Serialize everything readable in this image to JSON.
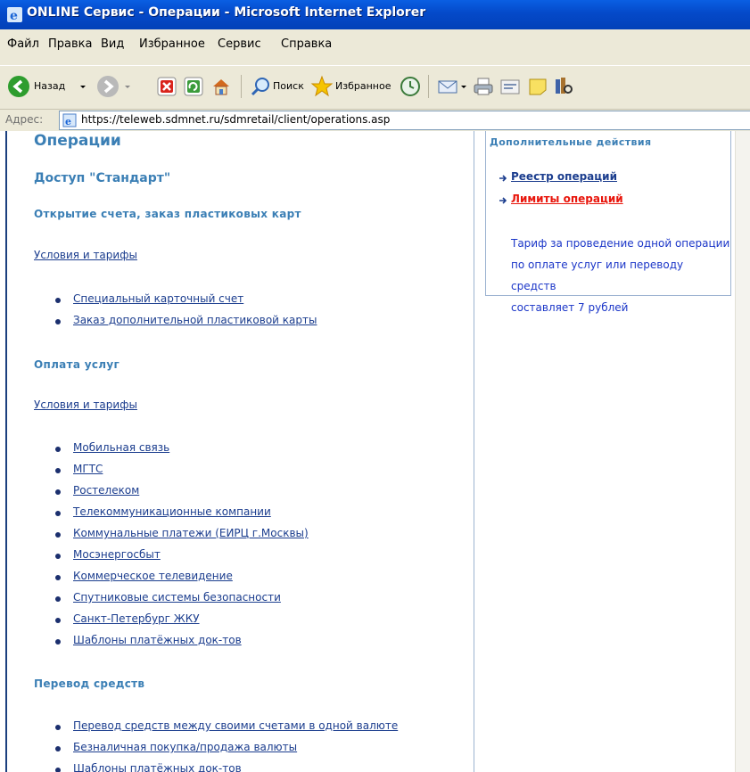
{
  "window": {
    "title": "ONLINE Сервис - Операции - Microsoft Internet Explorer"
  },
  "menu": [
    "Файл",
    "Правка",
    "Вид",
    "Избранное",
    "Сервис",
    "Справка"
  ],
  "toolbar": {
    "back_label": "Назад",
    "search_label": "Поиск",
    "favorites_label": "Избранное"
  },
  "address": {
    "label": "Адрес:",
    "url": "https://teleweb.sdmnet.ru/sdmretail/client/operations.asp"
  },
  "page": {
    "title": "Операции",
    "access": "Доступ \"Стандарт\"",
    "sections": [
      {
        "heading": "Открытие счета, заказ пластиковых карт",
        "terms": "Условия и тарифы",
        "items": [
          "Специальный карточный счет",
          "Заказ дополнительной пластиковой карты"
        ]
      },
      {
        "heading": "Оплата услуг",
        "terms": "Условия и тарифы",
        "items": [
          "Мобильная связь",
          "МГТС",
          "Ростелеком",
          "Телекоммуникационные компании",
          "Коммунальные платежи (ЕИРЦ г.Москвы)",
          "Мосэнергосбыт",
          "Коммерческое телевидение",
          "Спутниковые системы безопасности",
          "Санкт-Петербург ЖКУ",
          "Шаблоны платёжных док-тов"
        ]
      },
      {
        "heading": "Перевод средств",
        "items": [
          "Перевод средств между своими счетами в одной валюте",
          "Безналичная покупка/продажа валюты",
          "Шаблоны платёжных док-тов"
        ]
      }
    ]
  },
  "panel": {
    "title": "Дополнительные действия",
    "links": [
      {
        "label": "Реестр операций",
        "color": "#1B3D8E"
      },
      {
        "label": "Лимиты операций",
        "color": "#E8150B"
      }
    ],
    "note_lines": [
      "Тариф за проведение одной операции",
      "по оплате услуг или переводу средств",
      "составляет 7 рублей"
    ]
  },
  "colors": {
    "heading": "#3B7FB5",
    "link": "#1B3D8E",
    "note": "#1B36C8",
    "alert_link": "#E8150B"
  }
}
